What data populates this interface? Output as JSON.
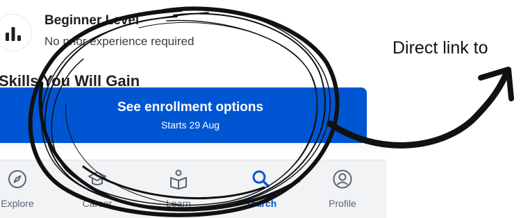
{
  "level": {
    "icon": "bar-chart-icon",
    "title": "Beginner Level",
    "subtitle": "No prior experience required"
  },
  "skills_heading": "Skills You Will Gain",
  "enroll_button": {
    "label": "See enrollment options",
    "sublabel": "Starts 29 Aug"
  },
  "nav": {
    "items": [
      {
        "label": "Explore",
        "icon": "compass-icon",
        "active": false
      },
      {
        "label": "Career",
        "icon": "graduation-cap-icon",
        "active": false
      },
      {
        "label": "Learn",
        "icon": "open-book-icon",
        "active": false
      },
      {
        "label": "Search",
        "icon": "search-icon",
        "active": true
      },
      {
        "label": "Profile",
        "icon": "profile-icon",
        "active": false
      }
    ]
  },
  "annotation": {
    "text": "Direct link to"
  },
  "colors": {
    "accent": "#0056d2",
    "nav_background": "#f2f3f5",
    "nav_text": "#5b6470",
    "annotation_ink": "#111111"
  }
}
